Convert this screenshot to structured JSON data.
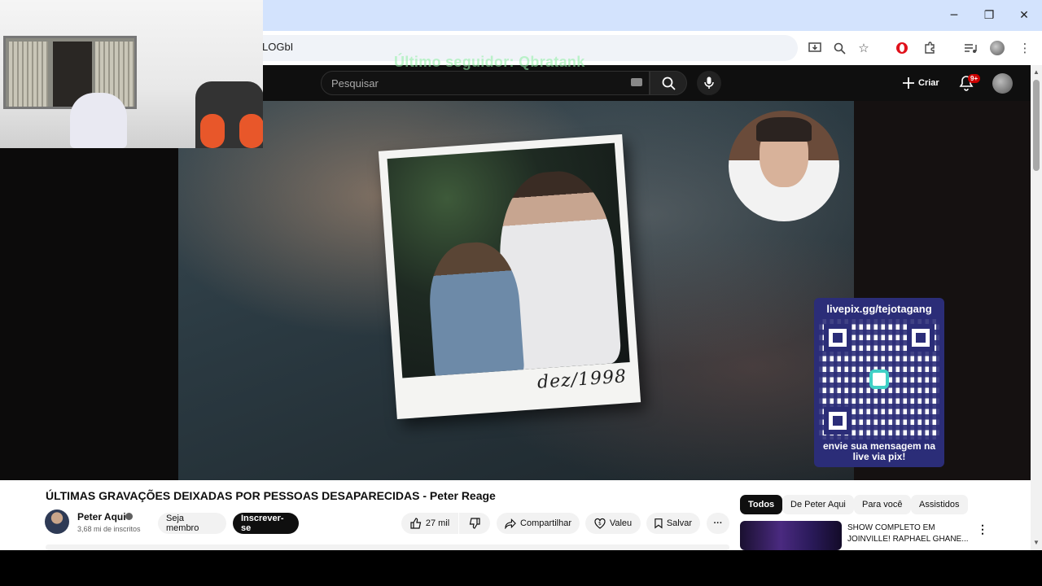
{
  "browser": {
    "url_fragment": "LOGbI",
    "controls": {
      "minimize": "─",
      "restore": "❐",
      "close": "✕"
    },
    "toolbar_icons": [
      "install-app-icon",
      "zoom-icon",
      "star-icon",
      "opera-icon",
      "extensions-icon",
      "media-icon",
      "profile-icon",
      "menu-icon"
    ]
  },
  "header": {
    "search_placeholder": "Pesquisar",
    "create_label": "Criar",
    "notifications_badge": "9+"
  },
  "stream_overlay": {
    "follower_text": "Último seguidor: Qbratank",
    "photo_caption": "dez/1998",
    "pix_title": "livepix.gg/tejotagang",
    "pix_message": "envie sua mensagem na live via pix!"
  },
  "video": {
    "title": "ÚLTIMAS GRAVAÇÕES DEIXADAS POR PESSOAS DESAPARECIDAS - Peter Reage",
    "channel_name": "Peter Aqui",
    "subscribers": "3,68 mi de inscritos",
    "join_label": "Seja membro",
    "subscribe_label": "Inscrever-se",
    "likes": "27 mil",
    "share_label": "Compartilhar",
    "thanks_label": "Valeu",
    "save_label": "Salvar"
  },
  "sidebar": {
    "filters": [
      "Todos",
      "De Peter Aqui",
      "Para você",
      "Assistidos"
    ],
    "related": [
      {
        "title": "SHOW COMPLETO EM JOINVILLE! RAPHAEL GHANE..."
      }
    ]
  },
  "colors": {
    "header_bg": "#0f0f0f",
    "pix_card": "#2b2d78",
    "follower_text": "#8ff0a4",
    "badge": "#cc0000"
  }
}
